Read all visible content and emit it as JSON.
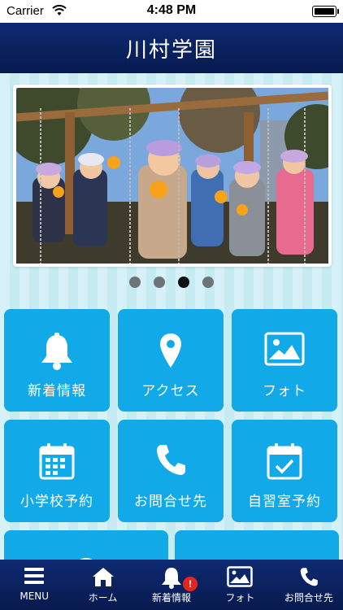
{
  "status_bar": {
    "carrier": "Carrier",
    "time": "4:48 PM"
  },
  "header": {
    "title": "川村学園"
  },
  "carousel": {
    "page_count": 4,
    "active_index": 2
  },
  "tiles": [
    {
      "label": "新着情報",
      "icon": "bell-icon"
    },
    {
      "label": "アクセス",
      "icon": "map-pin-icon"
    },
    {
      "label": "フォト",
      "icon": "photo-icon"
    },
    {
      "label": "小学校予約",
      "icon": "calendar-icon"
    },
    {
      "label": "お問合せ先",
      "icon": "phone-icon"
    },
    {
      "label": "自習室予約",
      "icon": "calendar-check-icon"
    }
  ],
  "tab_bar": {
    "items": [
      {
        "label": "MENU",
        "icon": "menu-icon"
      },
      {
        "label": "ホーム",
        "icon": "home-icon"
      },
      {
        "label": "新着情報",
        "icon": "bell-icon",
        "badge": "!"
      },
      {
        "label": "フォト",
        "icon": "photo-icon"
      },
      {
        "label": "お問合せ先",
        "icon": "phone-icon"
      }
    ]
  },
  "colors": {
    "header": "#0a1f5c",
    "tile": "#12a9e8",
    "badge": "#e2261d",
    "background": "#cfeef5"
  }
}
